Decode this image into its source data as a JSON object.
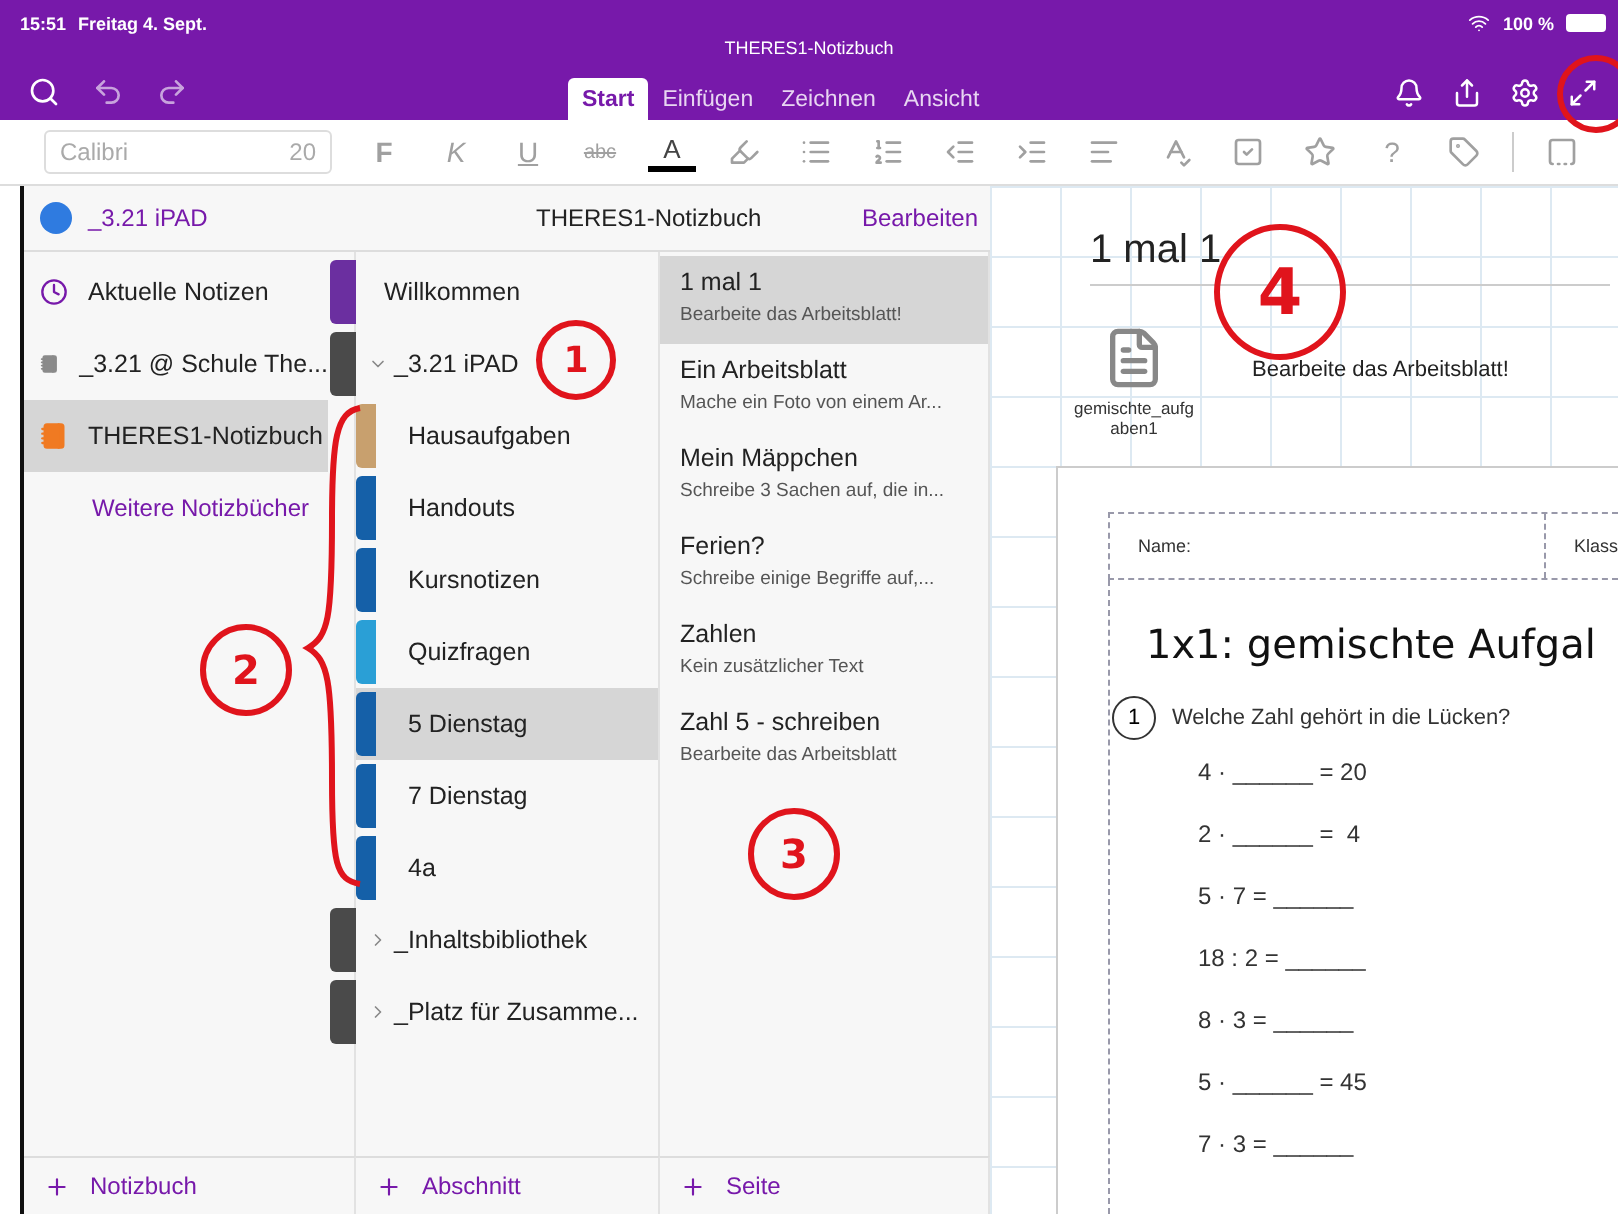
{
  "status_bar": {
    "time": "15:51",
    "date": "Freitag 4. Sept.",
    "battery": "100 %"
  },
  "window": {
    "title": "THERES1-Notizbuch"
  },
  "tabs": [
    {
      "label": "Start",
      "selected": true
    },
    {
      "label": "Einfügen",
      "selected": false
    },
    {
      "label": "Zeichnen",
      "selected": false
    },
    {
      "label": "Ansicht",
      "selected": false
    }
  ],
  "toolbar": {
    "font_field": {
      "value": "Calibri",
      "size": "20"
    },
    "items": [
      {
        "kind": "glyph",
        "label": "F"
      },
      {
        "kind": "glyph",
        "label": "K"
      },
      {
        "kind": "glyph",
        "label": "U"
      },
      {
        "kind": "glyph",
        "label": "abc"
      },
      {
        "kind": "glyph",
        "label": "A"
      },
      {
        "kind": "icon"
      },
      {
        "kind": "icon"
      },
      {
        "kind": "icon"
      },
      {
        "kind": "icon"
      },
      {
        "kind": "icon"
      },
      {
        "kind": "icon"
      },
      {
        "kind": "icon"
      },
      {
        "kind": "icon"
      },
      {
        "kind": "icon"
      },
      {
        "kind": "glyph",
        "label": "?"
      },
      {
        "kind": "icon"
      },
      {
        "kind": "separator"
      },
      {
        "kind": "icon"
      }
    ]
  },
  "notebooks": {
    "header": "_3.21 iPAD",
    "items": [
      {
        "kind": "recent",
        "name": "Aktuelle Notizen",
        "selected": false
      },
      {
        "kind": "notebook",
        "name": "_3.21 @ Schule The...",
        "color": "#8a8a8a",
        "selected": false
      },
      {
        "kind": "notebook",
        "name": "THERES1-Notizbuch",
        "color": "#f07a22",
        "selected": true
      },
      {
        "kind": "link",
        "name": "Weitere Notizbücher",
        "selected": false
      }
    ],
    "add": "Notizbuch"
  },
  "sections": {
    "header": "THERES1-Notizbuch",
    "edit": "Bearbeiten",
    "items": [
      {
        "kind": "section",
        "name": "Willkommen",
        "color": "#6b2fa0",
        "selected": false
      },
      {
        "kind": "group",
        "name": "_3.21 iPAD",
        "color": "#4a4a4a",
        "expanded": true,
        "children": [
          {
            "kind": "section",
            "name": "Hausaufgaben",
            "color": "#c8a06e",
            "selected": false
          },
          {
            "kind": "section",
            "name": "Handouts",
            "color": "#1560a8",
            "selected": false
          },
          {
            "kind": "section",
            "name": "Kursnotizen",
            "color": "#1560a8",
            "selected": false
          },
          {
            "kind": "section",
            "name": "Quizfragen",
            "color": "#2a9fd6",
            "selected": false
          },
          {
            "kind": "section",
            "name": "5 Dienstag",
            "color": "#1560a8",
            "selected": true
          },
          {
            "kind": "section",
            "name": "7 Dienstag",
            "color": "#1560a8",
            "selected": false
          },
          {
            "kind": "section",
            "name": "4a",
            "color": "#1560a8",
            "selected": false
          }
        ]
      },
      {
        "kind": "group",
        "name": "_Inhaltsbibliothek",
        "color": "#4a4a4a",
        "expanded": false
      },
      {
        "kind": "group",
        "name": "_Platz für Zusamme...",
        "color": "#4a4a4a",
        "expanded": false
      }
    ],
    "add": "Abschnitt"
  },
  "pages": {
    "items": [
      {
        "title": "1 mal 1",
        "preview": "Bearbeite das Arbeitsblatt!",
        "selected": true
      },
      {
        "title": "Ein Arbeitsblatt",
        "preview": "Mache ein Foto von einem Ar...",
        "selected": false
      },
      {
        "title": "Mein Mäppchen",
        "preview": "Schreibe 3 Sachen auf, die in...",
        "selected": false
      },
      {
        "title": "Ferien?",
        "preview": "Schreibe einige Begriffe auf,...",
        "selected": false
      },
      {
        "title": "Zahlen",
        "preview": "Kein zusätzlicher Text",
        "selected": false
      },
      {
        "title": "Zahl 5 - schreiben",
        "preview": "Bearbeite das Arbeitsblatt",
        "selected": false
      }
    ],
    "add": "Seite"
  },
  "canvas": {
    "title": "1 mal 1",
    "attachment": "gemischte_aufgaben1",
    "note": "Bearbeite das Arbeitsblatt!",
    "worksheet": {
      "name_label": "Name:",
      "class_label": "Klass",
      "title": "1x1: gemischte Aufgal",
      "task_number": "1",
      "question": "Welche Zahl gehört in die Lücken?",
      "equations": [
        "4 · ______ = 20",
        "2 · ______ =  4",
        "5 · 7 = ______",
        "18 : 2 = ______",
        "8 · 3 = ______",
        "5 · ______ = 45",
        "7 · 3 = ______"
      ]
    }
  },
  "annotations": [
    {
      "text": "1"
    },
    {
      "text": "2"
    },
    {
      "text": "3"
    },
    {
      "text": "4"
    }
  ]
}
